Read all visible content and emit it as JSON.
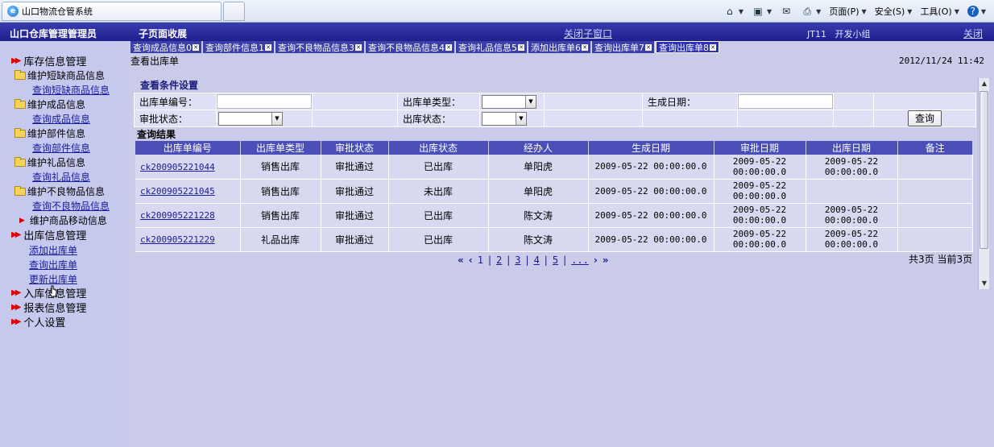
{
  "browser": {
    "tab_title": "山口物流仓管系统",
    "menu": [
      "页面(P)",
      "安全(S)",
      "工具(O)"
    ]
  },
  "header": {
    "brand": "山口仓库管理管理员",
    "subpage_collapse": "子页面收展",
    "close_child": "关闭子窗口",
    "dept_code": "JT11",
    "dept_name": "开发小组",
    "close": "关闭"
  },
  "sidebar": {
    "inventory": {
      "title": "库存信息管理",
      "groups": [
        {
          "label": "维护短缺商品信息",
          "link": "查询短缺商品信息"
        },
        {
          "label": "维护成品信息",
          "link": "查询成品信息"
        },
        {
          "label": "维护部件信息",
          "link": "查询部件信息"
        },
        {
          "label": "维护礼品信息",
          "link": "查询礼品信息"
        },
        {
          "label": "维护不良物品信息",
          "link": "查询不良物品信息"
        }
      ],
      "move": "维护商品移动信息"
    },
    "outbound": {
      "title": "出库信息管理",
      "links": [
        "添加出库单",
        "查询出库单",
        "更新出库单"
      ]
    },
    "inbound": "入库信息管理",
    "report": "报表信息管理",
    "personal": "个人设置"
  },
  "subtabs": [
    "查询成品信息0",
    "查询部件信息1",
    "查询不良物品信息3",
    "查询不良物品信息4",
    "查询礼品信息5",
    "添加出库单6",
    "查询出库单7",
    "查询出库单8"
  ],
  "page": {
    "title": "查看出库单",
    "datetime": "2012/11/24 11:42"
  },
  "conditions": {
    "title": "查看条件设置",
    "order_no_label": "出库单编号：",
    "order_type_label": "出库单类型：",
    "create_date_label": "生成日期：",
    "approve_status_label": "审批状态：",
    "out_status_label": "出库状态：",
    "query_button": "查询"
  },
  "results": {
    "title": "查询结果",
    "columns": [
      "出库单编号",
      "出库单类型",
      "审批状态",
      "出库状态",
      "经办人",
      "生成日期",
      "审批日期",
      "出库日期",
      "备注"
    ],
    "rows": [
      {
        "id": "ck200905221044",
        "type": "销售出库",
        "approve": "审批通过",
        "status": "已出库",
        "handler": "单阳虎",
        "created": "2009-05-22 00:00:00.0",
        "approve_date_1": "2009-05-22",
        "approve_date_2": "00:00:00.0",
        "out_date_1": "2009-05-22",
        "out_date_2": "00:00:00.0",
        "note": ""
      },
      {
        "id": "ck200905221045",
        "type": "销售出库",
        "approve": "审批通过",
        "status": "未出库",
        "handler": "单阳虎",
        "created": "2009-05-22 00:00:00.0",
        "approve_date_1": "2009-05-22",
        "approve_date_2": "00:00:00.0",
        "out_date_1": "",
        "out_date_2": "",
        "note": ""
      },
      {
        "id": "ck200905221228",
        "type": "销售出库",
        "approve": "审批通过",
        "status": "已出库",
        "handler": "陈文涛",
        "created": "2009-05-22 00:00:00.0",
        "approve_date_1": "2009-05-22",
        "approve_date_2": "00:00:00.0",
        "out_date_1": "2009-05-22",
        "out_date_2": "00:00:00.0",
        "note": ""
      },
      {
        "id": "ck200905221229",
        "type": "礼品出库",
        "approve": "审批通过",
        "status": "已出库",
        "handler": "陈文涛",
        "created": "2009-05-22 00:00:00.0",
        "approve_date_1": "2009-05-22",
        "approve_date_2": "00:00:00.0",
        "out_date_1": "2009-05-22",
        "out_date_2": "00:00:00.0",
        "note": ""
      }
    ]
  },
  "pager": {
    "first": "«",
    "prev": "‹",
    "pages": [
      "1",
      "2",
      "3",
      "4",
      "5",
      "..."
    ],
    "next": "›",
    "last": "»",
    "info": "共3页 当前3页"
  },
  "colors": {
    "header_bg": "#1f1f8e",
    "sidebar_bg": "#c5c9ee",
    "table_header": "#4a4eb6",
    "link": "#1a1a9a"
  }
}
